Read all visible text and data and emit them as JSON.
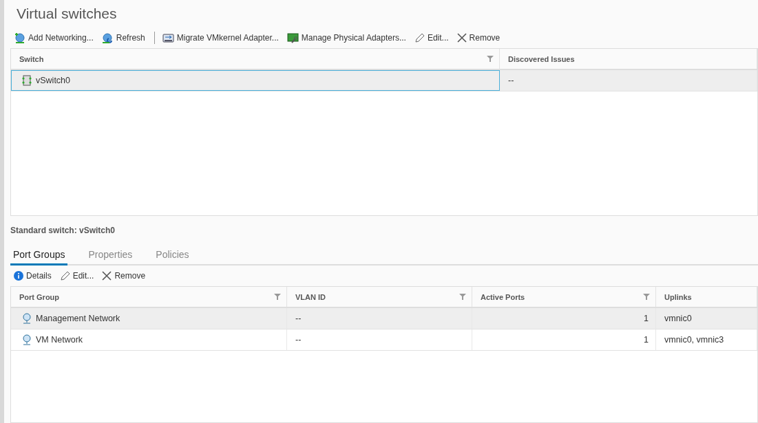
{
  "title": "Virtual switches",
  "toolbar": [
    {
      "kind": "add-network",
      "label": "Add Networking..."
    },
    {
      "kind": "refresh",
      "label": "Refresh"
    },
    {
      "kind": "separator"
    },
    {
      "kind": "migrate",
      "label": "Migrate VMkernel Adapter..."
    },
    {
      "kind": "manage",
      "label": "Manage Physical Adapters..."
    },
    {
      "kind": "edit",
      "label": "Edit..."
    },
    {
      "kind": "remove",
      "label": "Remove"
    }
  ],
  "switch_table": {
    "columns": [
      {
        "label": "Switch",
        "filterable": true
      },
      {
        "label": "Discovered Issues",
        "filterable": false
      }
    ],
    "rows": [
      {
        "selected": true,
        "cells": [
          "vSwitch0",
          "--"
        ]
      }
    ]
  },
  "detail_title": "Standard switch: vSwitch0",
  "tabs": [
    {
      "label": "Port Groups",
      "selected": true
    },
    {
      "label": "Properties",
      "selected": false
    },
    {
      "label": "Policies",
      "selected": false
    }
  ],
  "detail_toolbar": [
    {
      "kind": "details",
      "label": "Details"
    },
    {
      "kind": "edit",
      "label": "Edit..."
    },
    {
      "kind": "remove",
      "label": "Remove"
    }
  ],
  "port_group_table": {
    "columns": [
      {
        "label": "Port Group",
        "filterable": true
      },
      {
        "label": "VLAN ID",
        "filterable": true
      },
      {
        "label": "Active Ports",
        "filterable": true
      },
      {
        "label": "Uplinks",
        "filterable": false
      }
    ],
    "rows": [
      {
        "selected": true,
        "cells": [
          "Management Network",
          "--",
          "1",
          "vmnic0"
        ]
      },
      {
        "selected": false,
        "cells": [
          "VM Network",
          "--",
          "1",
          "vmnic0, vmnic3"
        ]
      }
    ]
  }
}
